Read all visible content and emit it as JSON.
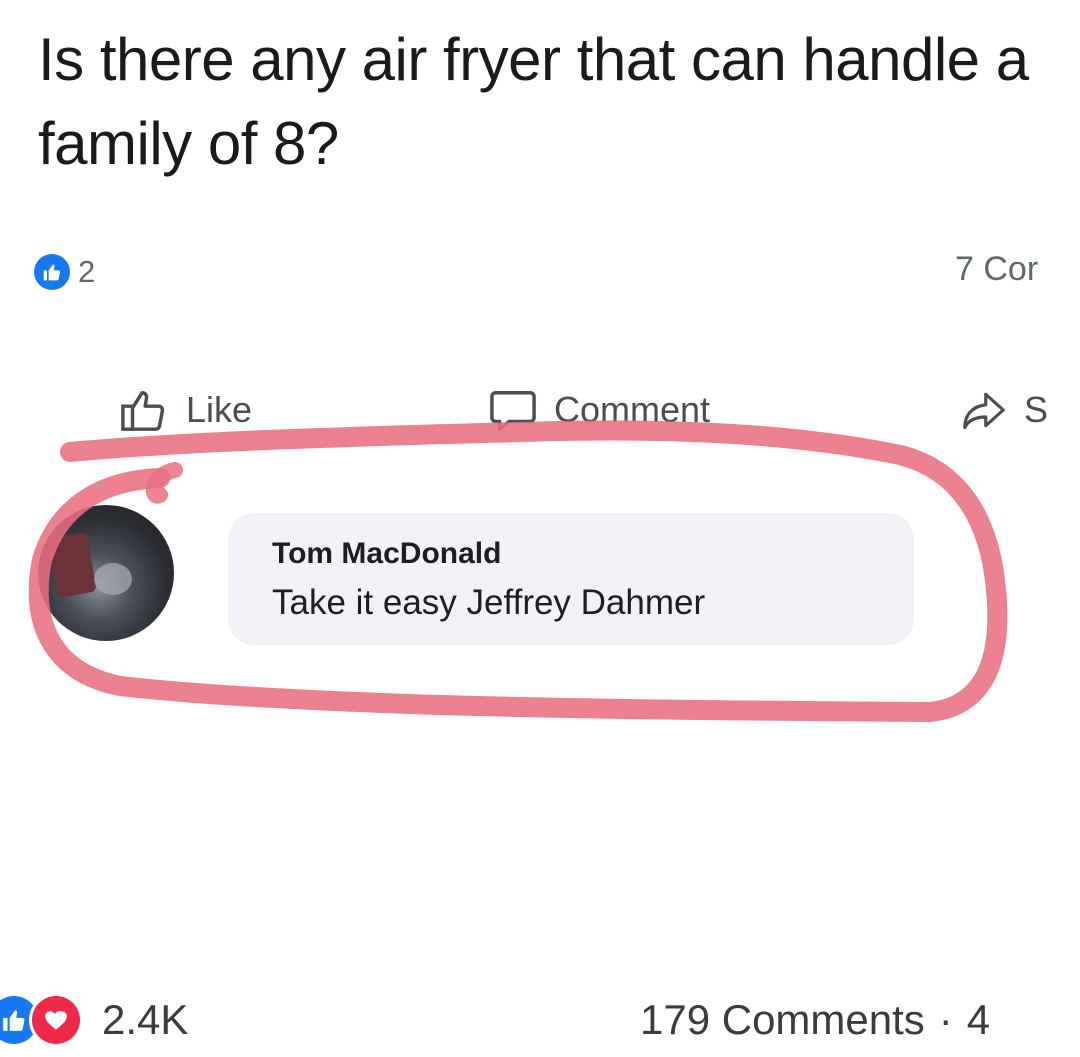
{
  "post": {
    "text": "Is there any air fryer that can handle a family of 8?",
    "reaction_count": "2",
    "comments_count": "7 Cor"
  },
  "actions": {
    "like_label": "Like",
    "comment_label": "Comment",
    "share_label": "S"
  },
  "comment": {
    "author": "Tom MacDonald",
    "text": "Take it easy Jeffrey Dahmer"
  },
  "footer": {
    "reaction_count": "2.4K",
    "comments_label": "179 Comments",
    "separator": "·",
    "trailing": "4"
  },
  "colors": {
    "like_blue": "#1877f2",
    "love_red": "#f0284a",
    "circle_marker": "#e8707f"
  },
  "icons": [
    "like-icon",
    "thumbs-up-icon",
    "comment-icon",
    "share-icon",
    "heart-icon"
  ]
}
